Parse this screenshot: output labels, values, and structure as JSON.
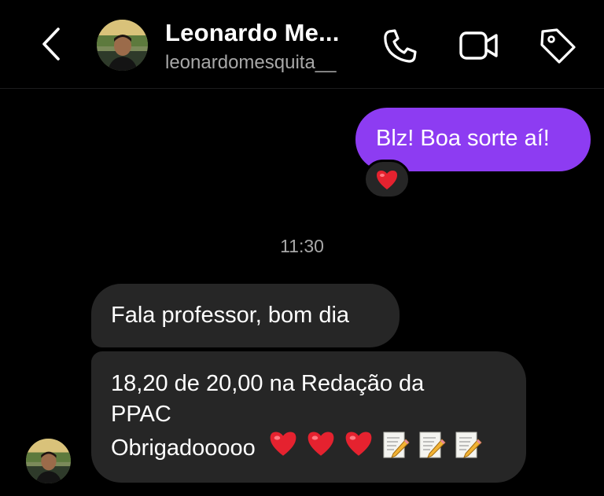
{
  "header": {
    "back_icon": "chevron-left-icon",
    "contact_name": "Leonardo Me...",
    "contact_handle": "leonardomesquita__",
    "icons": [
      "phone-icon",
      "video-camera-icon",
      "tag-icon"
    ]
  },
  "messages": {
    "sent_text": "Blz! Boa sorte aí!",
    "sent_reaction": "red-heart-emoji",
    "timestamp": "11:30",
    "received": [
      {
        "lines": [
          "Fala professor, bom dia"
        ]
      },
      {
        "lines": [
          "18,20 de 20,00 na Redação da",
          "PPAC",
          "Obrigadooooo"
        ],
        "trailing_emojis": [
          "red-heart",
          "red-heart",
          "red-heart",
          "memo",
          "memo",
          "memo"
        ]
      }
    ]
  },
  "colors": {
    "background": "#000000",
    "sent_bubble": "#8d3cf2",
    "received_bubble": "#262626",
    "secondary_text": "#a8a8a8"
  }
}
